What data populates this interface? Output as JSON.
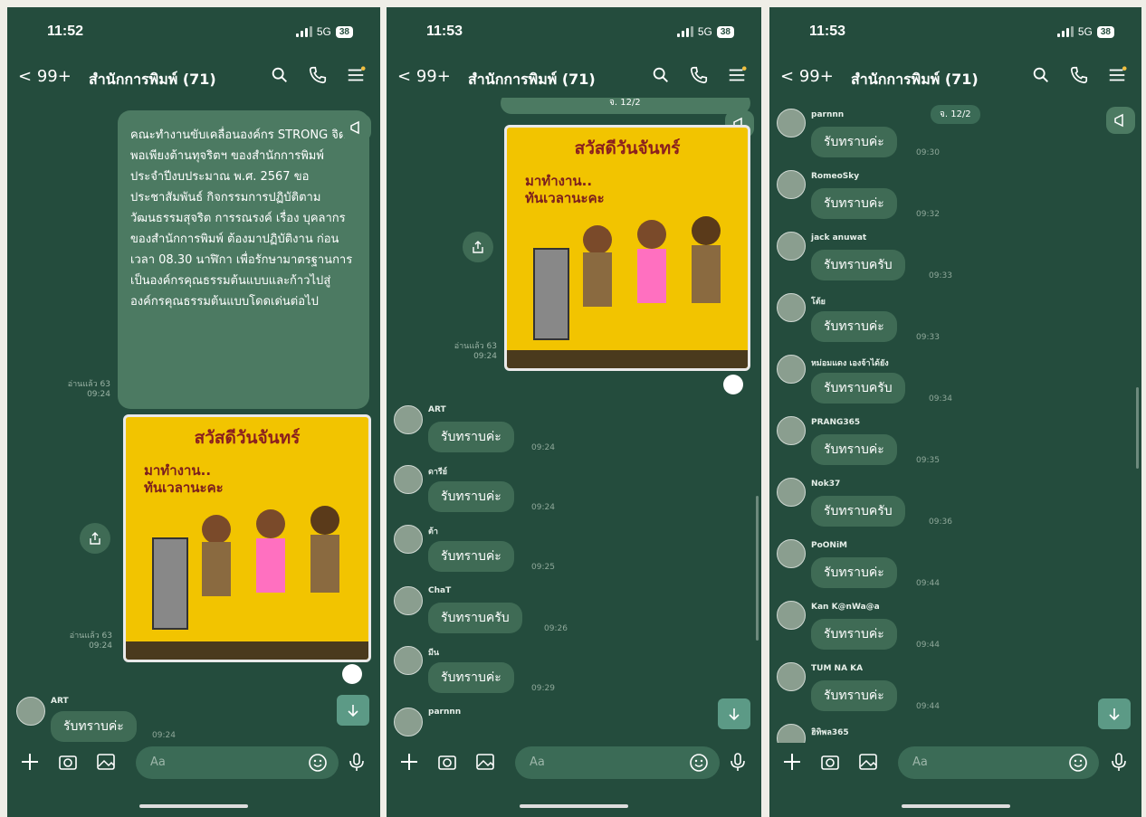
{
  "chat": {
    "back": "<",
    "count": "99+",
    "title": "สำนักการพิมพ์ (71)",
    "input_placeholder": "Aa",
    "reply_text": "รับทราบค่ะ",
    "reply_text_m": "รับทราบครับ"
  },
  "screens": [
    {
      "time": "11:52",
      "network": "5G",
      "battery": "38",
      "announcement": "คณะทำงานขับเคลื่อนองค์กร STRONG จิตพอเพียงต้านทุจริตฯ ของสำนักการพิมพ์ ประจำปีงบประมาณ พ.ศ. 2567 ขอประชาสัมพันธ์ กิจกรรมการปฏิบัติตามวัฒนธรรมสุจริต การรณรงค์ เรื่อง บุคลากรของสำนักการพิมพ์ ต้องมาปฏิบัติงาน ก่อนเวลา 08.30 นาฬิกา เพื่อรักษามาตรฐานการเป็นองค์กรคุณธรรมต้นแบบและก้าวไปสู่องค์กรคุณธรรมต้นแบบโดดเด่นต่อไป",
      "read1": "อ่านแล้ว 63",
      "time1": "09:24",
      "poster_title": "สวัสดีวันจันทร์",
      "poster_sub1": "มาทำงาน..",
      "poster_sub2": "ทันเวลานะคะ",
      "read2": "อ่านแล้ว 63",
      "time2": "09:24",
      "first_name": "ART",
      "first_msg": "รับทราบค่ะ",
      "first_time": "09:24"
    },
    {
      "time": "11:53",
      "network": "5G",
      "battery": "38",
      "top_note": "จ. 12/2",
      "read": "อ่านแล้ว 63",
      "time_read": "09:24",
      "poster_title": "สวัสดีวันจันทร์",
      "poster_sub1": "มาทำงาน..",
      "poster_sub2": "ทันเวลานะคะ",
      "messages": [
        {
          "name": "ART",
          "text": "รับทราบค่ะ",
          "time": "09:24"
        },
        {
          "name": "ดารีย์",
          "text": "รับทราบค่ะ",
          "time": "09:24"
        },
        {
          "name": "ต้า",
          "text": "รับทราบค่ะ",
          "time": "09:25"
        },
        {
          "name": "ChaT",
          "text": "รับทราบครับ",
          "time": "09:26"
        },
        {
          "name": "มีน",
          "text": "รับทราบค่ะ",
          "time": "09:29"
        },
        {
          "name": "parnnn",
          "text": "",
          "time": ""
        }
      ]
    },
    {
      "time": "11:53",
      "network": "5G",
      "battery": "38",
      "date_chip": "จ. 12/2",
      "messages": [
        {
          "name": "parnnn",
          "text": "รับทราบค่ะ",
          "time": "09:30"
        },
        {
          "name": "RomeoSky",
          "text": "รับทราบค่ะ",
          "time": "09:32"
        },
        {
          "name": "jack anuwat",
          "text": "รับทราบครับ",
          "time": "09:33"
        },
        {
          "name": "โต้ย",
          "text": "รับทราบค่ะ",
          "time": "09:33"
        },
        {
          "name": "หม่อมแดง เองจ้าได้ยัง",
          "text": "รับทราบครับ",
          "time": "09:34"
        },
        {
          "name": "PRANG365",
          "text": "รับทราบค่ะ",
          "time": "09:35"
        },
        {
          "name": "Nok37",
          "text": "รับทราบครับ",
          "time": "09:36"
        },
        {
          "name": "PoONiM",
          "text": "รับทราบค่ะ",
          "time": "09:44"
        },
        {
          "name": "Kan K@nWa@a",
          "text": "รับทราบค่ะ",
          "time": "09:44"
        },
        {
          "name": "TUM NA KA",
          "text": "รับทราบค่ะ",
          "time": "09:44"
        },
        {
          "name": "ฮิทิพล365",
          "text": "",
          "time": ""
        }
      ]
    }
  ],
  "colors": {
    "bg": "#244c3d",
    "bubble": "#3f6b55",
    "accent": "#5c9a86",
    "poster": "#f2c400"
  }
}
